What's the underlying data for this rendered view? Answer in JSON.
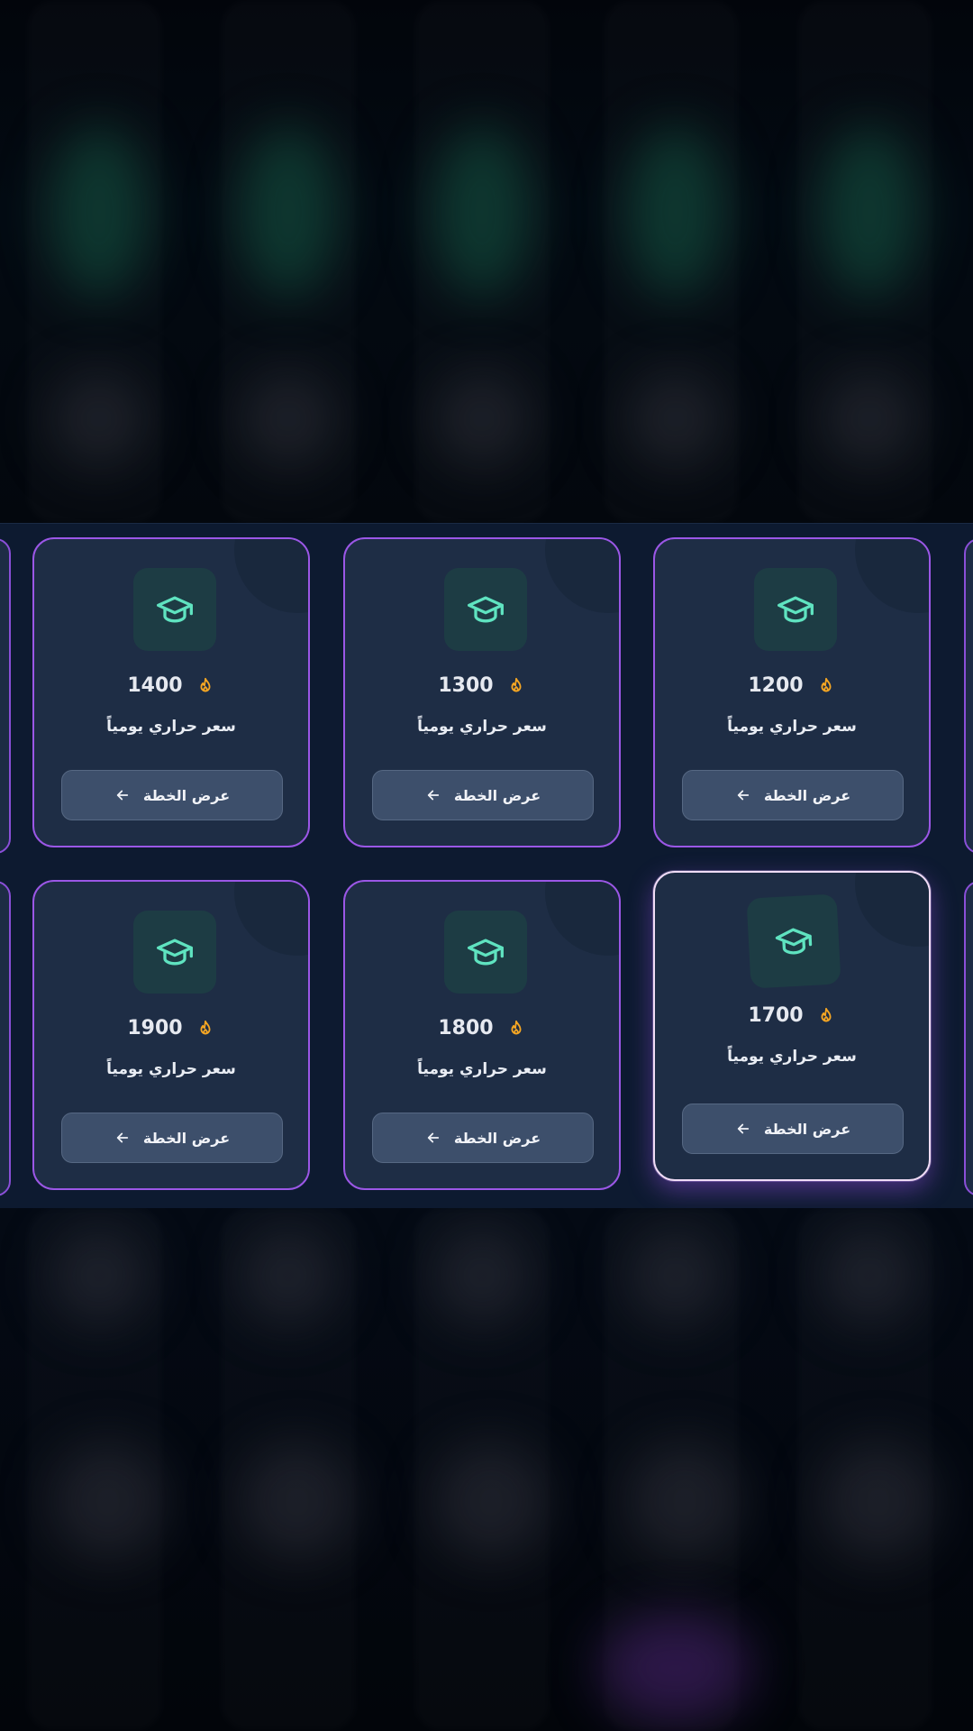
{
  "colors": {
    "card_border": "#9b57e6",
    "card_border_selected": "#f0dcf6",
    "card_bg": "#1e2d45",
    "icon_accent": "#5fe3c0",
    "flame": "#f5a623",
    "button_bg": "#3d4f6b"
  },
  "icons": {
    "plan_icon": "graduation-cap-icon",
    "calorie_icon": "flame-icon",
    "button_icon": "arrow-left-icon"
  },
  "plans": [
    {
      "calories": "1400",
      "label": "سعر حراري يومياً",
      "button": "عرض الخطة",
      "selected": false
    },
    {
      "calories": "1300",
      "label": "سعر حراري يومياً",
      "button": "عرض الخطة",
      "selected": false
    },
    {
      "calories": "1200",
      "label": "سعر حراري يومياً",
      "button": "عرض الخطة",
      "selected": false
    },
    {
      "calories": "1900",
      "label": "سعر حراري يومياً",
      "button": "عرض الخطة",
      "selected": false
    },
    {
      "calories": "1800",
      "label": "سعر حراري يومياً",
      "button": "عرض الخطة",
      "selected": false
    },
    {
      "calories": "1700",
      "label": "سعر حراري يومياً",
      "button": "عرض الخطة",
      "selected": true
    }
  ]
}
